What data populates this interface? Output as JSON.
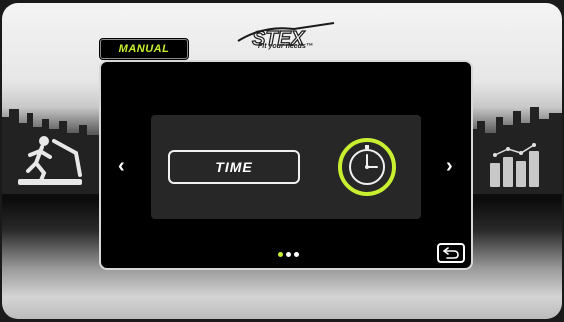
{
  "header": {
    "mode_label": "MANUAL",
    "logo_text": "STEX",
    "logo_tagline": "Fit your needs™"
  },
  "program": {
    "option_label": "TIME",
    "option_icon": "stopwatch-icon"
  },
  "navigation": {
    "prev_icon": "chevron-left-icon",
    "next_icon": "chevron-right-icon",
    "prev_glyph": "‹",
    "next_glyph": "›",
    "back_icon": "back-return-icon",
    "page_count": 3,
    "active_page": 1
  },
  "colors": {
    "accent": "#c8f030",
    "screen_bg": "#000000",
    "panel_bg": "#272727",
    "text": "#ffffff"
  },
  "decor": {
    "left_icon": "treadmill-runner-icon",
    "right_icon": "bar-graph-icon",
    "background": "city-skyline"
  }
}
